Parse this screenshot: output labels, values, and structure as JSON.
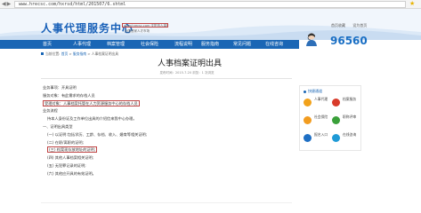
{
  "browser": {
    "url": "www.hrecsc.com/hxrsd/html/201507/6.shtml"
  },
  "header": {
    "site_title": "人事代理服务中心",
    "domain_box_text": "www.hrecsc.com 沈阳市人事局",
    "slogan": "全国首家人才市场",
    "links": [
      "首页收藏",
      "设为首页"
    ],
    "hotline": "96560"
  },
  "nav": {
    "items": [
      "首页",
      "人事代理",
      "档案管理",
      "社会保险",
      "流程说明",
      "服务指南",
      "常见问题",
      "在线咨询"
    ]
  },
  "breadcrumb": {
    "home": "当前位置:",
    "items": [
      "首页",
      "服务指南",
      "人事档案证明出具"
    ],
    "separator": ">"
  },
  "article": {
    "title": "人事档案证明出具",
    "meta": "发布时间：2015-7-20   浏览：1  次浏览",
    "lines": [
      {
        "text": "业务事项：开具证明",
        "style": "indent2"
      },
      {
        "text": "服务对象：有此需求的存档人员",
        "style": "indent2"
      },
      {
        "text": "受理对象：人事档案托管在人力资源服务中心的存档人员",
        "style": "indent2",
        "highlight": true
      },
      {
        "text": "业务流程",
        "style": "indent2"
      },
      {
        "text": "持本人身份证及工作单位出具的介绍信来我中心办理。",
        "style": "indent1"
      },
      {
        "text": "一、证明出具类型",
        "style": "indent2"
      },
      {
        "text": "(一) 以证明:包括学历、工龄、存档、收入、婚育等相关证明;",
        "style": "indent1"
      },
      {
        "text": "(二) 在职/离职的证明;",
        "style": "indent1"
      },
      {
        "text": "(三) 档案现存放地址的证明;",
        "style": "indent1",
        "highlight": true
      },
      {
        "text": "(四) 其他人事档案相关证明;",
        "style": "indent1"
      },
      {
        "text": "(五) 无犯罪记录的证明;",
        "style": "indent1"
      },
      {
        "text": "(六) 其他应开具的有效证明。",
        "style": "indent1"
      }
    ]
  },
  "sidebar": {
    "heading": "快捷通道",
    "items": [
      {
        "label": "人事代理",
        "color": "#f2a21a"
      },
      {
        "label": "档案服务",
        "color": "#d83b2a"
      },
      {
        "label": "社会保险",
        "color": "#f29c1f"
      },
      {
        "label": "职称评审",
        "color": "#3aa03a"
      },
      {
        "label": "报名入口",
        "color": "#1e6fc4"
      },
      {
        "label": "在线咨询",
        "color": "#1f9ad6"
      }
    ]
  },
  "colors": {
    "brand": "#1a66b5",
    "highlight_border": "#c04545"
  }
}
